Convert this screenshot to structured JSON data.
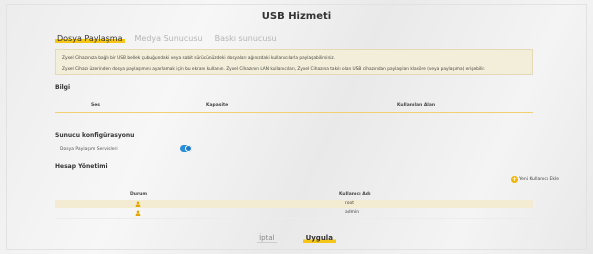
{
  "page": {
    "title": "USB Hizmeti"
  },
  "tabs": [
    {
      "label": "Dosya Paylaşma",
      "active": true
    },
    {
      "label": "Medya Sunucusu",
      "active": false
    },
    {
      "label": "Baskı sunucusu",
      "active": false
    }
  ],
  "info": {
    "line1": "Zyxel Cihazınıza bağlı bir USB bellek çubuğundaki veya sabit sürücünüzdeki dosyaları ağınızdaki kullanıcılarla paylaşabilirsiniz.",
    "line2": "Zyxel Cihazı üzerinden dosya paylaşımını ayarlamak için bu ekranı kullanın. Zyxel Cihazının LAN kullanıcıları, Zyxel Cihazına takılı olan USB cihazından paylaşılan klasöre (veya paylaşıma) erişebilir."
  },
  "bilgi": {
    "heading": "Bilgi",
    "columns": [
      "Ses",
      "Kapasite",
      "Kullanılan Alan"
    ]
  },
  "server_config": {
    "heading": "Sunucu konfigürasyonu",
    "toggle_label": "Dosya Paylaşım Servisleri",
    "toggle_on": true
  },
  "accounts": {
    "heading": "Hesap Yönetimi",
    "add_user_label": "Yeni Kullanıcı Ekle",
    "columns": [
      "Durum",
      "Kullanıcı Adı"
    ],
    "rows": [
      {
        "status_icon": "user-status-icon",
        "username": "root"
      },
      {
        "status_icon": "user-status-icon",
        "username": "admin"
      }
    ]
  },
  "buttons": {
    "cancel": "İptal",
    "apply": "Uygula"
  },
  "colors": {
    "accent": "#f5c518",
    "toggle": "#2a8fd6",
    "info_bg": "#f3eed9"
  }
}
